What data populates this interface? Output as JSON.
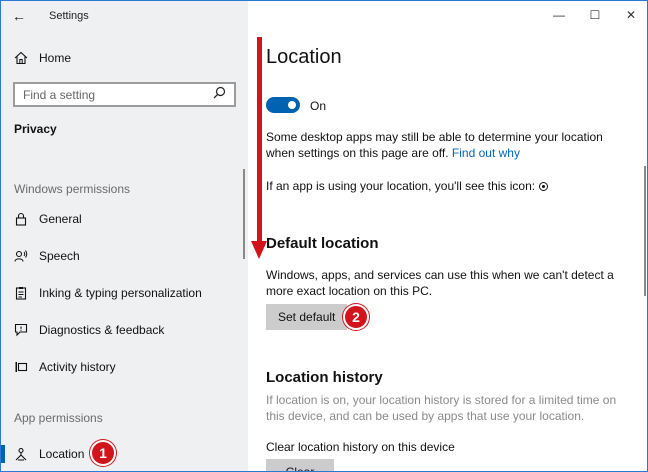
{
  "window": {
    "title": "Settings",
    "back_glyph": "←",
    "controls": {
      "minimize": "—",
      "maximize": "☐",
      "close": "✕"
    }
  },
  "sidebar": {
    "home": {
      "label": "Home",
      "icon": "home-icon"
    },
    "search": {
      "placeholder": "Find a setting",
      "icon": "search-icon"
    },
    "category": "Privacy",
    "windows_permissions_label": "Windows permissions",
    "windows_permissions": [
      {
        "label": "General",
        "icon": "lock-icon"
      },
      {
        "label": "Speech",
        "icon": "speech-icon"
      },
      {
        "label": "Inking & typing personalization",
        "icon": "clipboard-icon"
      },
      {
        "label": "Diagnostics & feedback",
        "icon": "feedback-icon"
      },
      {
        "label": "Activity history",
        "icon": "activity-icon"
      }
    ],
    "app_permissions_label": "App permissions",
    "app_permissions": [
      {
        "label": "Location",
        "icon": "location-icon",
        "active": true
      }
    ]
  },
  "main": {
    "title": "Location",
    "toggle": {
      "state": "On",
      "on": true
    },
    "info_text": "Some desktop apps may still be able to determine your location when settings on this page are off.",
    "info_link": "Find out why",
    "icon_text": "If an app is using your location, you'll see this icon:",
    "default_location": {
      "heading": "Default location",
      "text": "Windows, apps, and services can use this when we can't detect a more exact location on this PC.",
      "button": "Set default"
    },
    "location_history": {
      "heading": "Location history",
      "text": "If location is on, your location history is stored for a limited time on this device, and can be used by apps that use your location.",
      "clear_label": "Clear location history on this device",
      "clear_button": "Clear"
    }
  },
  "annotations": {
    "badge_1": "1",
    "badge_2": "2",
    "color": "#d3141b"
  },
  "colors": {
    "accent": "#0063b1",
    "link": "#0067c0",
    "sidebar_bg": "#eef0f1"
  }
}
